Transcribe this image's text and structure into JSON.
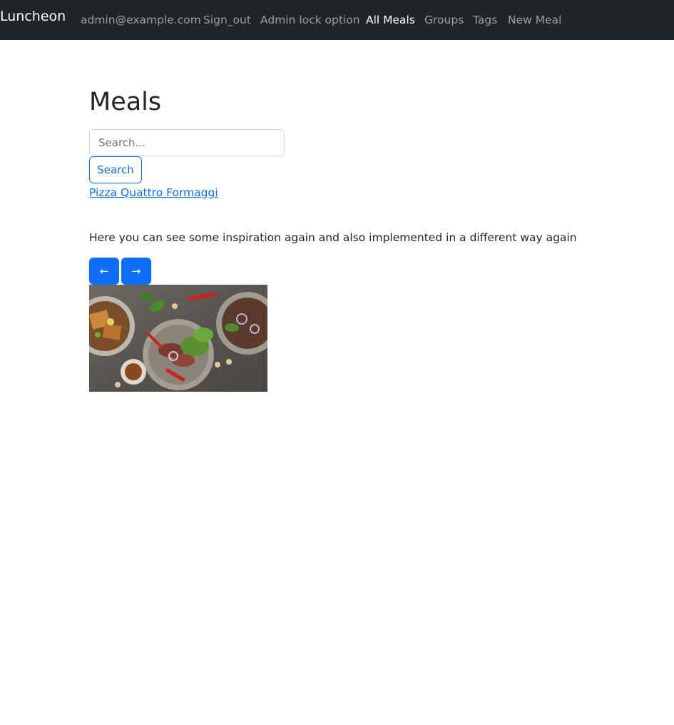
{
  "navbar": {
    "brand": "Luncheon",
    "links": [
      {
        "label": "admin@example.com",
        "active": false
      },
      {
        "label": "Sign_out",
        "active": false
      },
      {
        "label": "Admin lock option",
        "active": false
      },
      {
        "label": "All Meals",
        "active": true
      },
      {
        "label": "Groups",
        "active": false
      },
      {
        "label": "Tags",
        "active": false
      },
      {
        "label": "New Meal",
        "active": false
      }
    ]
  },
  "main": {
    "title": "Meals",
    "search": {
      "placeholder": "Search...",
      "value": "",
      "button_label": "Search"
    },
    "meals": [
      {
        "name": "Pizza Quattro Formaggi"
      }
    ],
    "inspiration_text": "Here you can see some inspiration again and also implemented in a different way again",
    "carousel": {
      "prev_label": "←",
      "next_label": "→",
      "image": {
        "icon": "food-photo"
      }
    }
  },
  "colors": {
    "navbar_bg": "#212529",
    "primary": "#0d6efd",
    "text": "#212529"
  }
}
